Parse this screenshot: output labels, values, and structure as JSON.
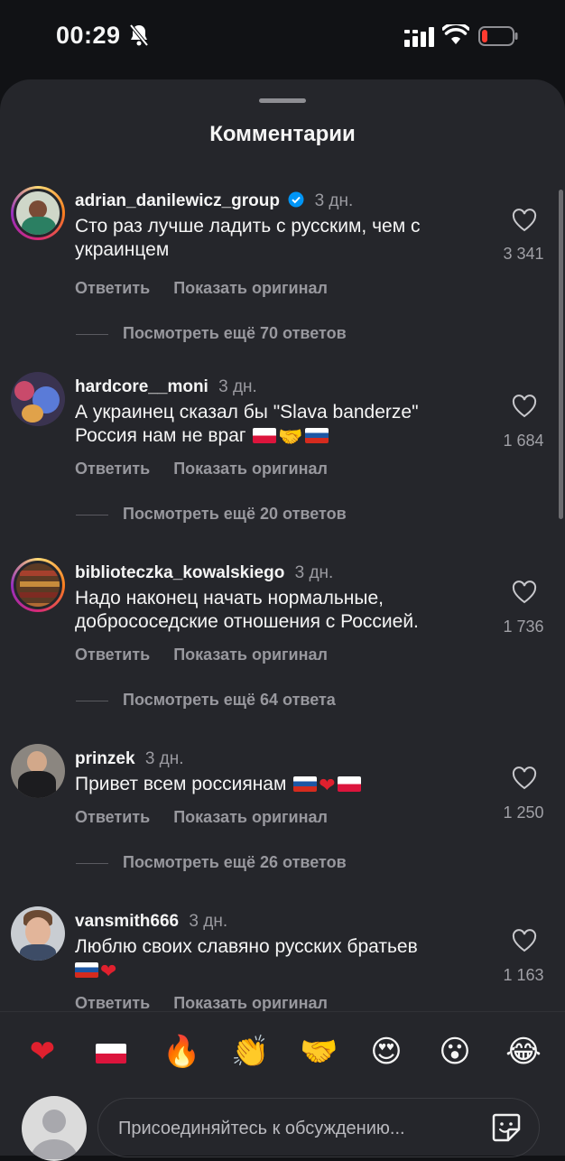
{
  "status": {
    "time": "00:29",
    "icons": [
      "bell-slash-icon",
      "cellular-signal-icon",
      "wifi-icon",
      "battery-low-icon"
    ]
  },
  "sheet": {
    "title": "Комментарии"
  },
  "labels": {
    "reply": "Ответить",
    "show_original": "Показать оригинал"
  },
  "comments": [
    {
      "username": "adrian_danilewicz_group",
      "verified": true,
      "age": "3 дн.",
      "text_lines": [
        "Сто раз лучше ладить с русским, чем с",
        "украинцем"
      ],
      "likes": "3 341",
      "replies": "Посмотреть ещё 70 ответов"
    },
    {
      "username": "hardcore__moni",
      "verified": false,
      "age": "3 дн.",
      "text_lines": [
        "А украинец сказал бы \"Slava banderze\"",
        "Россия нам не враг"
      ],
      "emojis": [
        "flag-poland",
        "handshake",
        "flag-russia"
      ],
      "likes": "1 684",
      "replies": "Посмотреть ещё 20 ответов"
    },
    {
      "username": "biblioteczka_kowalskiego",
      "verified": false,
      "age": "3 дн.",
      "text_lines": [
        "Надо наконец начать нормальные,",
        "добрососедские отношения с Россией."
      ],
      "likes": "1 736",
      "replies": "Посмотреть ещё 64 ответа"
    },
    {
      "username": "prinzek",
      "verified": false,
      "age": "3 дн.",
      "text_lines": [
        "Привет всем россиянам"
      ],
      "emojis": [
        "flag-russia",
        "red-heart",
        "flag-poland"
      ],
      "likes": "1 250",
      "replies": "Посмотреть ещё 26 ответов"
    },
    {
      "username": "vansmith666",
      "verified": false,
      "age": "3 дн.",
      "text_lines": [
        "Люблю своих славяно русских братьев"
      ],
      "emojis": [
        "flag-russia",
        "red-heart"
      ],
      "likes": "1 163"
    }
  ],
  "emoji_bar": [
    "red-heart",
    "flag-poland",
    "fire",
    "clapping-hands",
    "handshake",
    "heart-eyes",
    "surprised-face",
    "tears-of-joy"
  ],
  "compose": {
    "placeholder": "Присоединяйтесь к обсуждению..."
  },
  "colors": {
    "background": "#111215",
    "sheet": "#25262b",
    "muted_text": "#98989e",
    "verified_blue": "#0095f6"
  }
}
